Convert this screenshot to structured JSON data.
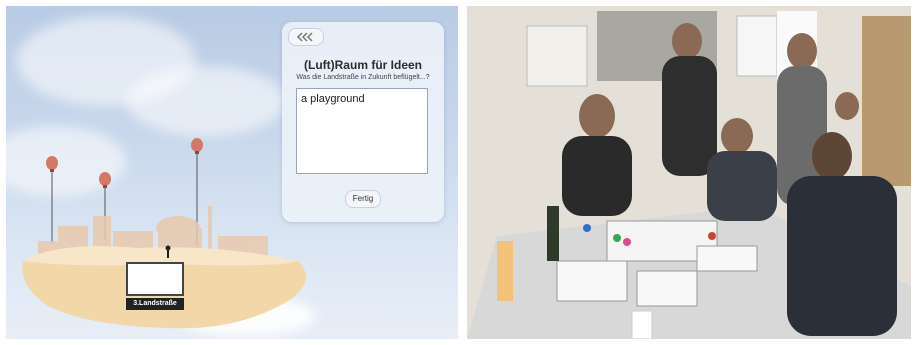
{
  "app": {
    "panel": {
      "back_icon": "double-chevron-left-icon",
      "title": "(Luft)Raum für Ideen",
      "subtitle": "Was die Landstraße in Zukunft beflügelt...?",
      "idea_text": "a playground",
      "done_label": "Fertig"
    },
    "island_sign": "3.Landstraße"
  },
  "photo": {
    "description_icon": "workshop-photo"
  }
}
